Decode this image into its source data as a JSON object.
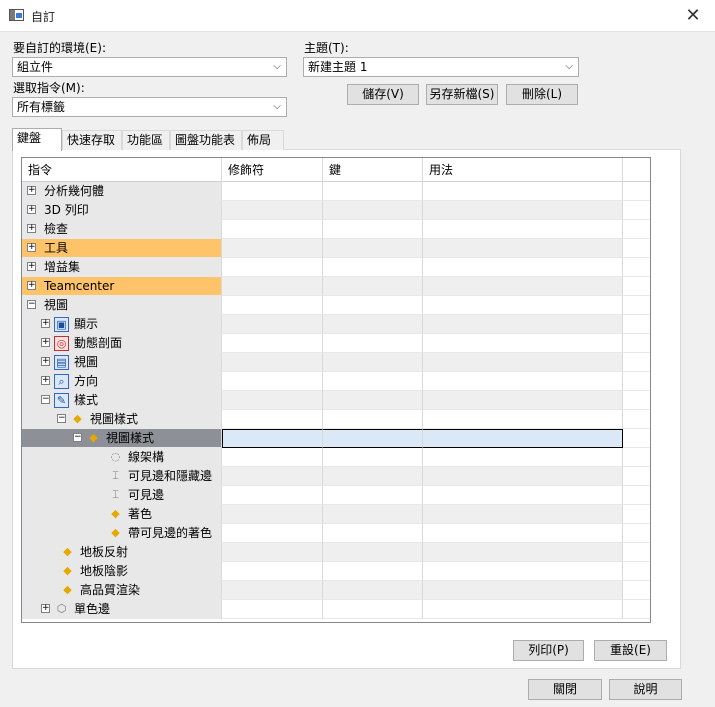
{
  "window": {
    "title": "自訂",
    "close_glyph": "✕"
  },
  "env": {
    "label": "要自訂的環境(E):",
    "value": "組立件"
  },
  "theme": {
    "label": "主題(T):",
    "value": "新建主題 1"
  },
  "cmd": {
    "label": "選取指令(M):",
    "value": "所有標籤"
  },
  "buttons": {
    "save": "儲存(V)",
    "save_as": "另存新檔(S)",
    "delete": "刪除(L)",
    "print": "列印(P)",
    "reset": "重設(E)",
    "close": "關閉",
    "help": "說明"
  },
  "tabs": [
    "鍵盤",
    "快速存取",
    "功能區",
    "圖盤功能表",
    "佈局"
  ],
  "columns": [
    "指令",
    "修飾符",
    "鍵",
    "用法"
  ],
  "rows": [
    {
      "label": "分析幾何體",
      "level": 0,
      "expander": "+",
      "icon": ""
    },
    {
      "label": "3D 列印",
      "level": 0,
      "expander": "+",
      "icon": ""
    },
    {
      "label": "檢查",
      "level": 0,
      "expander": "+",
      "icon": ""
    },
    {
      "label": "工具",
      "level": 0,
      "expander": "+",
      "icon": "",
      "highlight": true
    },
    {
      "label": "增益集",
      "level": 0,
      "expander": "+",
      "icon": ""
    },
    {
      "label": "Teamcenter",
      "level": 0,
      "expander": "+",
      "icon": "",
      "highlight": true
    },
    {
      "label": "視圖",
      "level": 0,
      "expander": "−",
      "icon": ""
    },
    {
      "label": "顯示",
      "level": 1,
      "expander": "+",
      "icon": "display-icon"
    },
    {
      "label": "動態剖面",
      "level": 1,
      "expander": "+",
      "icon": "section-icon"
    },
    {
      "label": "視圖",
      "level": 1,
      "expander": "+",
      "icon": "view-icon"
    },
    {
      "label": "方向",
      "level": 1,
      "expander": "+",
      "icon": "orient-icon"
    },
    {
      "label": "樣式",
      "level": 1,
      "expander": "−",
      "icon": "style-icon"
    },
    {
      "label": "視圖樣式",
      "level": 2,
      "expander": "−",
      "icon": "cube-icon"
    },
    {
      "label": "視圖樣式",
      "level": 3,
      "expander": "−",
      "icon": "cube-icon",
      "selected": true
    },
    {
      "label": "線架構",
      "level": 4,
      "expander": "",
      "icon": "wire-icon"
    },
    {
      "label": "可見邊和隱藏邊",
      "level": 4,
      "expander": "",
      "icon": "edge-icon"
    },
    {
      "label": "可見邊",
      "level": 4,
      "expander": "",
      "icon": "edge-icon"
    },
    {
      "label": "著色",
      "level": 4,
      "expander": "",
      "icon": "cube-icon"
    },
    {
      "label": "帶可見邊的著色",
      "level": 4,
      "expander": "",
      "icon": "cube-icon"
    },
    {
      "label": "地板反射",
      "level": 2,
      "expander": "",
      "icon": "cube-icon"
    },
    {
      "label": "地板陰影",
      "level": 2,
      "expander": "",
      "icon": "cube-icon"
    },
    {
      "label": "高品質渲染",
      "level": 2,
      "expander": "",
      "icon": "cube-icon"
    },
    {
      "label": "單色邊",
      "level": 1,
      "expander": "+",
      "icon": "mono-icon"
    }
  ]
}
